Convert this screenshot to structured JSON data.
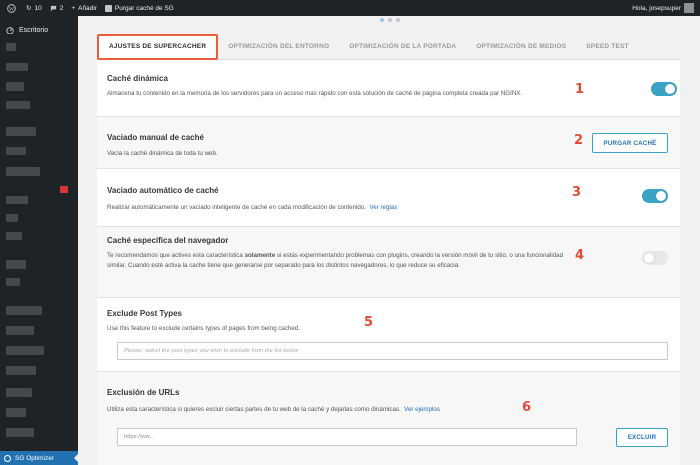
{
  "admin_bar": {
    "wp_logo_icon": "wordpress-icon",
    "home_icon": "home-icon",
    "updates_count": "10",
    "comments_count": "2",
    "add_new": "Añadir",
    "purge": "Purgar caché de SG",
    "greeting": "Hola, josepsuper"
  },
  "sidebar": {
    "dashboard": "Escritorio",
    "active_item": "SG Optimizer"
  },
  "tabs": [
    {
      "label": "AJUSTES DE SUPERCACHER",
      "active": true
    },
    {
      "label": "OPTIMIZACIÓN DEL ENTORNO",
      "active": false
    },
    {
      "label": "OPTIMIZACIÓN DE LA PORTADA",
      "active": false
    },
    {
      "label": "OPTIMIZACIÓN DE MEDIOS",
      "active": false
    },
    {
      "label": "SPEED TEST",
      "active": false
    }
  ],
  "sections": {
    "dynamic_cache": {
      "title": "Caché dinámica",
      "desc": "Almacena tu contenido en la memoria de los servidores para un acceso más rápido con esta solución de caché de página completa creada par NGINX.",
      "enabled": true,
      "number": "1"
    },
    "manual_purge": {
      "title": "Vaciado manual de caché",
      "desc": "Vacía la caché dinámica de toda tu web.",
      "button": "PURGAR CACHÉ",
      "number": "2"
    },
    "auto_purge": {
      "title": "Vaciado automático de caché",
      "desc": "Realizar automáticamente un vaciado inteligente de caché en cada modificación de contenido.",
      "link": "Ver reglas",
      "enabled": true,
      "number": "3"
    },
    "browser_cache": {
      "title": "Caché específica del navegador",
      "desc_before": "Te recomendamos que actives esta característica ",
      "desc_bold": "solamente",
      "desc_after": " si estás experimentando problemas con plugins, creando la versión móvil de tu sitio, o una funcionalidad similar. Cuando esté activa la cache tiene que generarse por separado para los distintos navegadores, lo que reduce su eficacia.",
      "enabled": false,
      "number": "4"
    },
    "exclude_post_types": {
      "title": "Exclude Post Types",
      "desc": "Use this feature to exclude certains types of pages from being cached.",
      "placeholder": "Please, select the post types you wish to exclude from the list below",
      "number": "5"
    },
    "url_exclusion": {
      "title": "Exclusión de URLs",
      "desc": "Utiliza esta característica si quieres excluir ciertas partes de tu web de la caché y dejarlas como dinámicas.",
      "link": "Ver ejemplos",
      "placeholder": "https://ww...",
      "button": "EXCLUIR",
      "number": "6"
    }
  },
  "colors": {
    "accent": "#3aa3c5",
    "annotation": "#e04b35",
    "admin_bar": "#1d2327",
    "active_menu": "#2271b1"
  }
}
